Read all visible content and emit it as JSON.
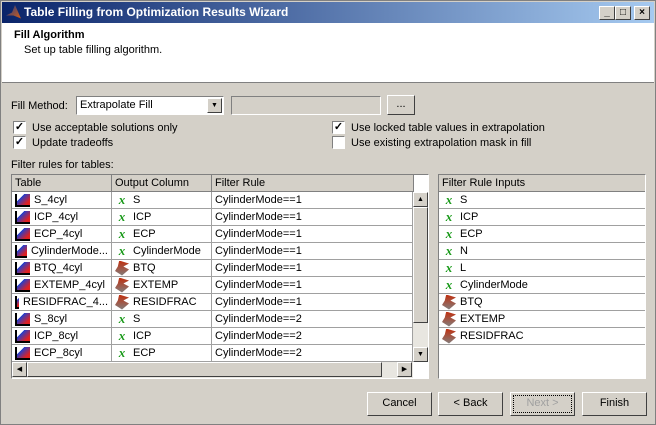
{
  "window": {
    "title": "Table Filling from Optimization Results Wizard",
    "controls": [
      "_",
      "□",
      "×"
    ]
  },
  "header": {
    "title": "Fill Algorithm",
    "subtitle": "Set up table filling algorithm."
  },
  "fill_method": {
    "label": "Fill Method:",
    "value": "Extrapolate Fill",
    "browse_label": "..."
  },
  "options": [
    {
      "label": "Use acceptable solutions only",
      "checked": true
    },
    {
      "label": "Update tradeoffs",
      "checked": true
    },
    {
      "label": "Use locked table values in extrapolation",
      "checked": true
    },
    {
      "label": "Use existing extrapolation mask in fill",
      "checked": false
    }
  ],
  "filter_label": "Filter rules for tables:",
  "rules_table": {
    "columns": [
      "Table",
      "Output Column",
      "Filter Rule"
    ],
    "rows": [
      {
        "table": "S_4cyl",
        "output": "S",
        "output_icon": "variable-icon",
        "rule": "CylinderMode==1"
      },
      {
        "table": "ICP_4cyl",
        "output": "ICP",
        "output_icon": "variable-icon",
        "rule": "CylinderMode==1"
      },
      {
        "table": "ECP_4cyl",
        "output": "ECP",
        "output_icon": "variable-icon",
        "rule": "CylinderMode==1"
      },
      {
        "table": "CylinderMode...",
        "output": "CylinderMode",
        "output_icon": "variable-icon",
        "rule": "CylinderMode==1"
      },
      {
        "table": "BTQ_4cyl",
        "output": "BTQ",
        "output_icon": "model-icon",
        "rule": "CylinderMode==1"
      },
      {
        "table": "EXTEMP_4cyl",
        "output": "EXTEMP",
        "output_icon": "model-icon",
        "rule": "CylinderMode==1"
      },
      {
        "table": "RESIDFRAC_4...",
        "output": "RESIDFRAC",
        "output_icon": "model-icon",
        "rule": "CylinderMode==1"
      },
      {
        "table": "S_8cyl",
        "output": "S",
        "output_icon": "variable-icon",
        "rule": "CylinderMode==2"
      },
      {
        "table": "ICP_8cyl",
        "output": "ICP",
        "output_icon": "variable-icon",
        "rule": "CylinderMode==2"
      },
      {
        "table": "ECP_8cyl",
        "output": "ECP",
        "output_icon": "variable-icon",
        "rule": "CylinderMode==2"
      }
    ]
  },
  "inputs_table": {
    "column": "Filter Rule Inputs",
    "rows": [
      {
        "label": "S",
        "icon": "variable-icon"
      },
      {
        "label": "ICP",
        "icon": "variable-icon"
      },
      {
        "label": "ECP",
        "icon": "variable-icon"
      },
      {
        "label": "N",
        "icon": "variable-icon"
      },
      {
        "label": "L",
        "icon": "variable-icon"
      },
      {
        "label": "CylinderMode",
        "icon": "variable-icon"
      },
      {
        "label": "BTQ",
        "icon": "model-icon"
      },
      {
        "label": "EXTEMP",
        "icon": "model-icon"
      },
      {
        "label": "RESIDFRAC",
        "icon": "model-icon"
      }
    ]
  },
  "buttons": {
    "cancel": "Cancel",
    "back": "< Back",
    "next": "Next >",
    "finish": "Finish"
  }
}
